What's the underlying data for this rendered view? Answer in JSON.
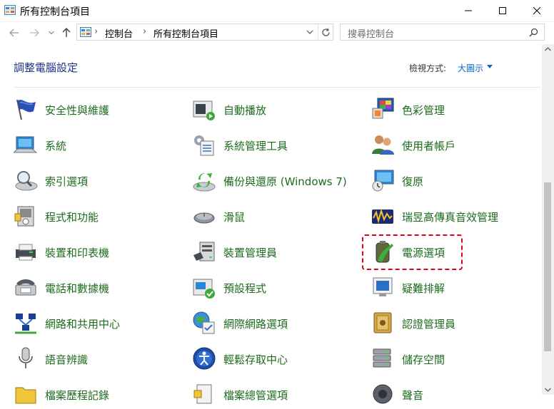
{
  "window": {
    "title": "所有控制台項目",
    "minimize": "–",
    "maximize": "☐",
    "close": "✕"
  },
  "address": {
    "crumb1": "控制台",
    "sep": "›",
    "crumb2": "所有控制台項目",
    "search_placeholder": "搜尋控制台"
  },
  "content": {
    "heading": "調整電腦設定",
    "view_by_label": "檢視方式:",
    "view_by_value": "大圖示"
  },
  "items": [
    {
      "label": "安全性與維護",
      "icon": "flag-icon"
    },
    {
      "label": "自動播放",
      "icon": "autoplay-icon"
    },
    {
      "label": "色彩管理",
      "icon": "color-management-icon"
    },
    {
      "label": "系統",
      "icon": "monitor-icon"
    },
    {
      "label": "系統管理工具",
      "icon": "admin-tools-icon"
    },
    {
      "label": "使用者帳戶",
      "icon": "users-icon"
    },
    {
      "label": "索引選項",
      "icon": "magnifier-icon"
    },
    {
      "label": "備份與還原 (Windows 7)",
      "icon": "backup-icon"
    },
    {
      "label": "復原",
      "icon": "recovery-icon"
    },
    {
      "label": "程式和功能",
      "icon": "programs-icon"
    },
    {
      "label": "滑鼠",
      "icon": "mouse-icon"
    },
    {
      "label": "瑞昱高傳真音效管理",
      "icon": "audio-manager-icon"
    },
    {
      "label": "裝置和印表機",
      "icon": "printer-icon"
    },
    {
      "label": "裝置管理員",
      "icon": "device-manager-icon"
    },
    {
      "label": "電源選項",
      "icon": "battery-icon"
    },
    {
      "label": "電話和數據機",
      "icon": "phone-icon"
    },
    {
      "label": "預設程式",
      "icon": "default-programs-icon"
    },
    {
      "label": "疑難排解",
      "icon": "troubleshoot-icon"
    },
    {
      "label": "網路和共用中心",
      "icon": "network-icon"
    },
    {
      "label": "網際網路選項",
      "icon": "globe-icon"
    },
    {
      "label": "認證管理員",
      "icon": "vault-icon"
    },
    {
      "label": "語音辨識",
      "icon": "microphone-icon"
    },
    {
      "label": "輕鬆存取中心",
      "icon": "accessibility-icon"
    },
    {
      "label": "儲存空間",
      "icon": "storage-icon"
    },
    {
      "label": "檔案歷程記錄",
      "icon": "folder-icon"
    },
    {
      "label": "檔案總管選項",
      "icon": "document-icon"
    },
    {
      "label": "聲音",
      "icon": "speaker-icon"
    }
  ]
}
